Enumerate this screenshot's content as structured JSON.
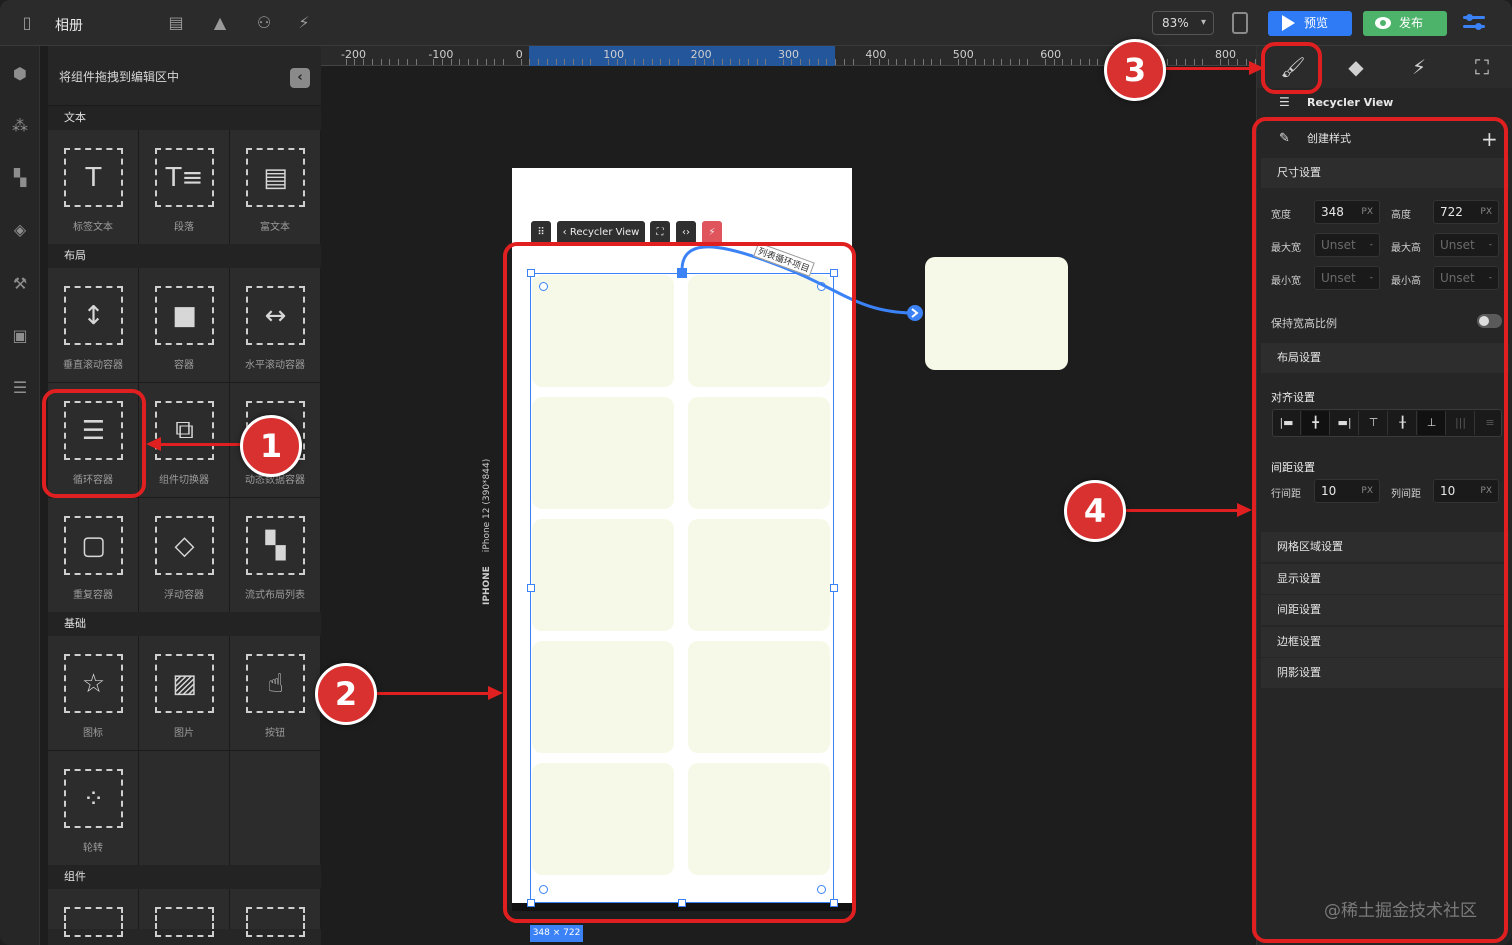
{
  "app": {
    "title": "相册",
    "zoom": "83%",
    "preview_label": "预览",
    "publish_label": "发布"
  },
  "left_panel": {
    "hint": "将组件拖拽到编辑区中",
    "sections": [
      {
        "label": "文本",
        "items": [
          {
            "label": "标签文本",
            "icon": "T"
          },
          {
            "label": "段落",
            "icon": "T≡"
          },
          {
            "label": "富文本",
            "icon": "▤"
          }
        ]
      },
      {
        "label": "布局",
        "items": [
          {
            "label": "垂直滚动容器",
            "icon": "↕"
          },
          {
            "label": "容器",
            "icon": "■"
          },
          {
            "label": "水平滚动容器",
            "icon": "↔"
          },
          {
            "label": "循环容器",
            "icon": "☰",
            "db": true
          },
          {
            "label": "组件切换器",
            "icon": "⧉"
          },
          {
            "label": "动态数据容器",
            "icon": "▦"
          },
          {
            "label": "重复容器",
            "icon": "▢",
            "db": true
          },
          {
            "label": "浮动容器",
            "icon": "◇"
          },
          {
            "label": "流式布局列表",
            "icon": "▚",
            "db": true
          }
        ]
      },
      {
        "label": "基础",
        "items": [
          {
            "label": "图标",
            "icon": "☆"
          },
          {
            "label": "图片",
            "icon": "▨"
          },
          {
            "label": "按钮",
            "icon": "☝"
          },
          {
            "label": "轮转",
            "icon": "⁘"
          }
        ]
      },
      {
        "label": "组件",
        "items": []
      }
    ]
  },
  "ruler": {
    "ticks": [
      "-200",
      "-100",
      "0",
      "100",
      "200",
      "300",
      "400",
      "500",
      "600",
      "700",
      "800"
    ]
  },
  "canvas": {
    "device_type": "IPHONE",
    "device_name": "iPhone 12 (390*844)",
    "component_chip": "Recycler View",
    "size_badge": "348 × 722",
    "connection_label": "列表循环项目"
  },
  "annotations": [
    "1",
    "2",
    "3",
    "4"
  ],
  "right_panel": {
    "component_name": "Recycler View",
    "create_style": "创建样式",
    "size_section": "尺寸设置",
    "width_label": "宽度",
    "width_value": "348",
    "width_unit": "PX",
    "height_label": "高度",
    "height_value": "722",
    "height_unit": "PX",
    "max_width_label": "最大宽",
    "max_width_value": "Unset",
    "max_height_label": "最大高",
    "max_height_value": "Unset",
    "min_width_label": "最小宽",
    "min_width_value": "Unset",
    "min_height_label": "最小高",
    "min_height_value": "Unset",
    "keep_ratio_label": "保持宽高比例",
    "layout_section": "布局设置",
    "align_label": "对齐设置",
    "spacing_label": "间距设置",
    "row_gap_label": "行间距",
    "row_gap_value": "10",
    "row_gap_unit": "PX",
    "col_gap_label": "列间距",
    "col_gap_value": "10",
    "col_gap_unit": "PX",
    "more_sections": [
      "网格区域设置",
      "显示设置",
      "间距设置",
      "边框设置",
      "阴影设置"
    ]
  },
  "watermark": "@稀土掘金技术社区",
  "colors": {
    "accent": "#3b82f6",
    "annotation_red": "#e02020",
    "publish_green": "#4db36a",
    "tile": "#f7f9e8"
  }
}
